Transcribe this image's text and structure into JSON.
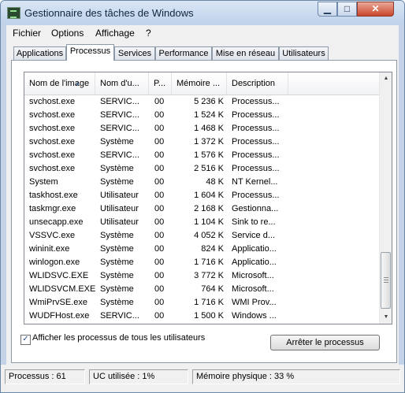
{
  "window": {
    "title": "Gestionnaire des tâches de Windows"
  },
  "menu": [
    "Fichier",
    "Options",
    "Affichage",
    "?"
  ],
  "tabs": [
    "Applications",
    "Processus",
    "Services",
    "Performance",
    "Mise en réseau",
    "Utilisateurs"
  ],
  "active_tab": "Processus",
  "columns": [
    "Nom de l'image",
    "Nom d'u...",
    "P...",
    "Mémoire ...",
    "Description"
  ],
  "rows": [
    [
      "svchost.exe",
      "SERVIC...",
      "00",
      "5 236 K",
      "Processus..."
    ],
    [
      "svchost.exe",
      "SERVIC...",
      "00",
      "1 524 K",
      "Processus..."
    ],
    [
      "svchost.exe",
      "SERVIC...",
      "00",
      "1 468 K",
      "Processus..."
    ],
    [
      "svchost.exe",
      "Système",
      "00",
      "1 372 K",
      "Processus..."
    ],
    [
      "svchost.exe",
      "SERVIC...",
      "00",
      "1 576 K",
      "Processus..."
    ],
    [
      "svchost.exe",
      "Système",
      "00",
      "2 516 K",
      "Processus..."
    ],
    [
      "System",
      "Système",
      "00",
      "48 K",
      "NT Kernel..."
    ],
    [
      "taskhost.exe",
      "Utilisateur",
      "00",
      "1 604 K",
      "Processus..."
    ],
    [
      "taskmgr.exe",
      "Utilisateur",
      "00",
      "2 168 K",
      "Gestionna..."
    ],
    [
      "unsecapp.exe",
      "Utilisateur",
      "00",
      "1 104 K",
      "Sink to re..."
    ],
    [
      "VSSVC.exe",
      "Système",
      "00",
      "4 052 K",
      "Service d..."
    ],
    [
      "wininit.exe",
      "Système",
      "00",
      "824 K",
      "Applicatio..."
    ],
    [
      "winlogon.exe",
      "Système",
      "00",
      "1 716 K",
      "Applicatio..."
    ],
    [
      "WLIDSVC.EXE",
      "Système",
      "00",
      "3 772 K",
      "Microsoft..."
    ],
    [
      "WLIDSVCM.EXE",
      "Système",
      "00",
      "764 K",
      "Microsoft..."
    ],
    [
      "WmiPrvSE.exe",
      "Système",
      "00",
      "1 716 K",
      "WMI Prov..."
    ],
    [
      "WUDFHost.exe",
      "SERVIC...",
      "00",
      "1 500 K",
      "Windows ..."
    ]
  ],
  "show_all_users": {
    "label": "Afficher les processus de tous les utilisateurs",
    "checked": true,
    "mark": "✓"
  },
  "end_process_button": "Arrêter le processus",
  "status": {
    "processes": "Processus : 61",
    "cpu": "UC utilisée : 1%",
    "memory": "Mémoire physique : 33 %"
  },
  "icons": {
    "app": "task-manager-icon",
    "minimize": "▁",
    "maximize": "□",
    "close": "✕",
    "sort": "▲",
    "scroll_up": "▲",
    "scroll_down": "▼"
  }
}
